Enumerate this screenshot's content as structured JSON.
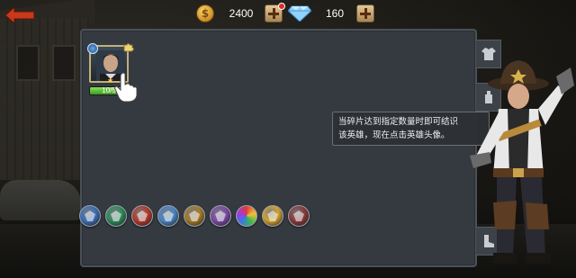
{
  "topbar": {
    "back_icon": "back-arrow-icon",
    "gold": {
      "icon": "coin-icon",
      "value": "2400"
    },
    "gems": {
      "icon": "diamond-icon",
      "value": "160"
    }
  },
  "hero_card": {
    "progress_label": "10/5",
    "progress_fraction": 1.0,
    "stars": "★"
  },
  "tooltip": {
    "line1": "当碎片达到指定数量时即可结识",
    "line2": "该英雄，现在点击英雄头像。"
  },
  "filters": [
    {
      "name": "filter-class-1",
      "color": "#3d6fb3"
    },
    {
      "name": "filter-class-2",
      "color": "#2f8a5a"
    },
    {
      "name": "filter-class-3",
      "color": "#b33a2c"
    },
    {
      "name": "filter-class-4",
      "color": "#4a86c4"
    },
    {
      "name": "filter-class-5",
      "color": "#a67a2a"
    },
    {
      "name": "filter-class-6",
      "color": "#7c4aa5"
    },
    {
      "name": "filter-all-colors",
      "color": "#c8c8c8"
    },
    {
      "name": "filter-gold",
      "color": "#d1a12e"
    },
    {
      "name": "filter-special",
      "color": "#8a3a3a"
    }
  ],
  "colors": {
    "panel_bg": "#343a40",
    "accent_red": "#c83a1c",
    "progress_green": "#3a9b24"
  }
}
